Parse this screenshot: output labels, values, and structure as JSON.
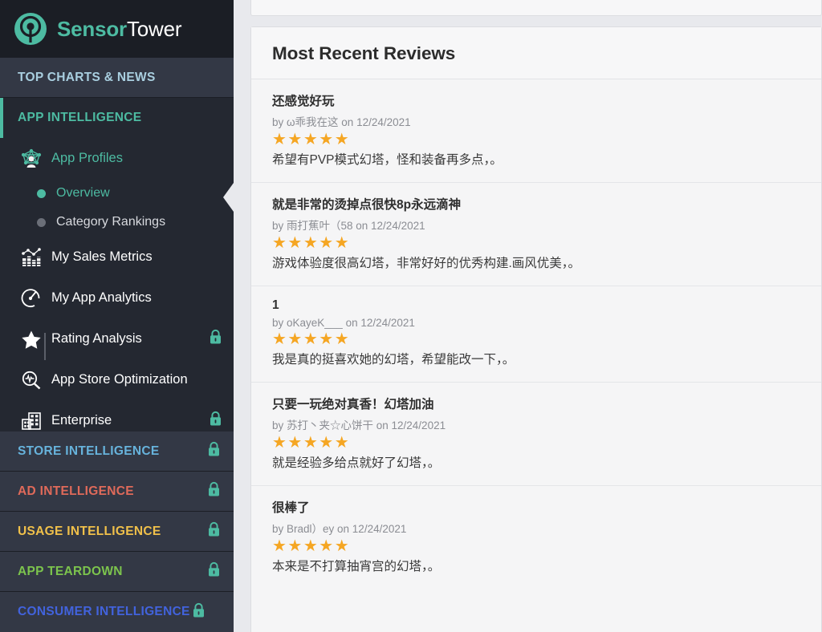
{
  "brand": {
    "name_bold": "Sensor",
    "name_light": "Tower",
    "logo_icon": "sensor-tower-logo-icon",
    "accent_color": "#4dbba2"
  },
  "sidebar": {
    "sections": [
      {
        "label": "TOP CHARTS & NEWS",
        "color": "#a9cfe0",
        "locked": false,
        "key": "topcharts"
      },
      {
        "label": "APP INTELLIGENCE",
        "color": "#4dbba2",
        "locked": false,
        "key": "appintel",
        "active": true
      }
    ],
    "nav_items": [
      {
        "label": "App Profiles",
        "icon": "network-profile-icon",
        "locked": false,
        "active": true
      },
      {
        "label": "My Sales Metrics",
        "icon": "bar-chart-icon",
        "locked": false,
        "active": false
      },
      {
        "label": "My App Analytics",
        "icon": "speedometer-icon",
        "locked": false,
        "active": false
      },
      {
        "label": "Rating Analysis",
        "icon": "star-icon",
        "locked": true,
        "active": false
      },
      {
        "label": "App Store Optimization",
        "icon": "magnifier-pulse-icon",
        "locked": false,
        "active": false
      },
      {
        "label": "Enterprise",
        "icon": "building-icon",
        "locked": true,
        "active": false
      }
    ],
    "children": [
      {
        "label": "Overview",
        "active": true
      },
      {
        "label": "Category Rankings",
        "active": false
      }
    ],
    "bottom_sections": [
      {
        "label": "STORE INTELLIGENCE",
        "color": "#67b3dc",
        "locked": true,
        "key": "store"
      },
      {
        "label": "AD INTELLIGENCE",
        "color": "#e06a5a",
        "locked": true,
        "key": "ad"
      },
      {
        "label": "USAGE INTELLIGENCE",
        "color": "#f0c04a",
        "locked": true,
        "key": "usage"
      },
      {
        "label": "APP TEARDOWN",
        "color": "#7cc44d",
        "locked": true,
        "key": "teardown"
      },
      {
        "label": "CONSUMER INTELLIGENCE",
        "color": "#4263dd",
        "locked": true,
        "key": "consumer"
      }
    ],
    "lock_icon": "lock-icon"
  },
  "main": {
    "panel_title": "Most Recent Reviews",
    "star_glyph": "★",
    "reviews": [
      {
        "title": "还感觉好玩",
        "meta": "by ω乖我在这 on 12/24/2021",
        "rating": 5,
        "body": "希望有PVP模式幻塔，怪和装备再多点，。"
      },
      {
        "title": "就是非常的烫掉点很快8p永远滴神",
        "meta": "by 雨打蕉叶（58 on 12/24/2021",
        "rating": 5,
        "body": "游戏体验度很高幻塔，非常好好的优秀构建.画风优美，。"
      },
      {
        "title": "1",
        "meta": "by oKayeK___ on 12/24/2021",
        "rating": 5,
        "body": "我是真的挺喜欢她的幻塔，希望能改一下，。"
      },
      {
        "title": "只要一玩绝对真香！幻塔加油",
        "meta": "by 苏打丶夹☆心饼干 on 12/24/2021",
        "rating": 5,
        "body": "就是经验多给点就好了幻塔，。"
      },
      {
        "title": "很棒了",
        "meta": "by Bradl）ey on 12/24/2021",
        "rating": 5,
        "body": "本来是不打算抽宵宫的幻塔，。"
      }
    ]
  }
}
